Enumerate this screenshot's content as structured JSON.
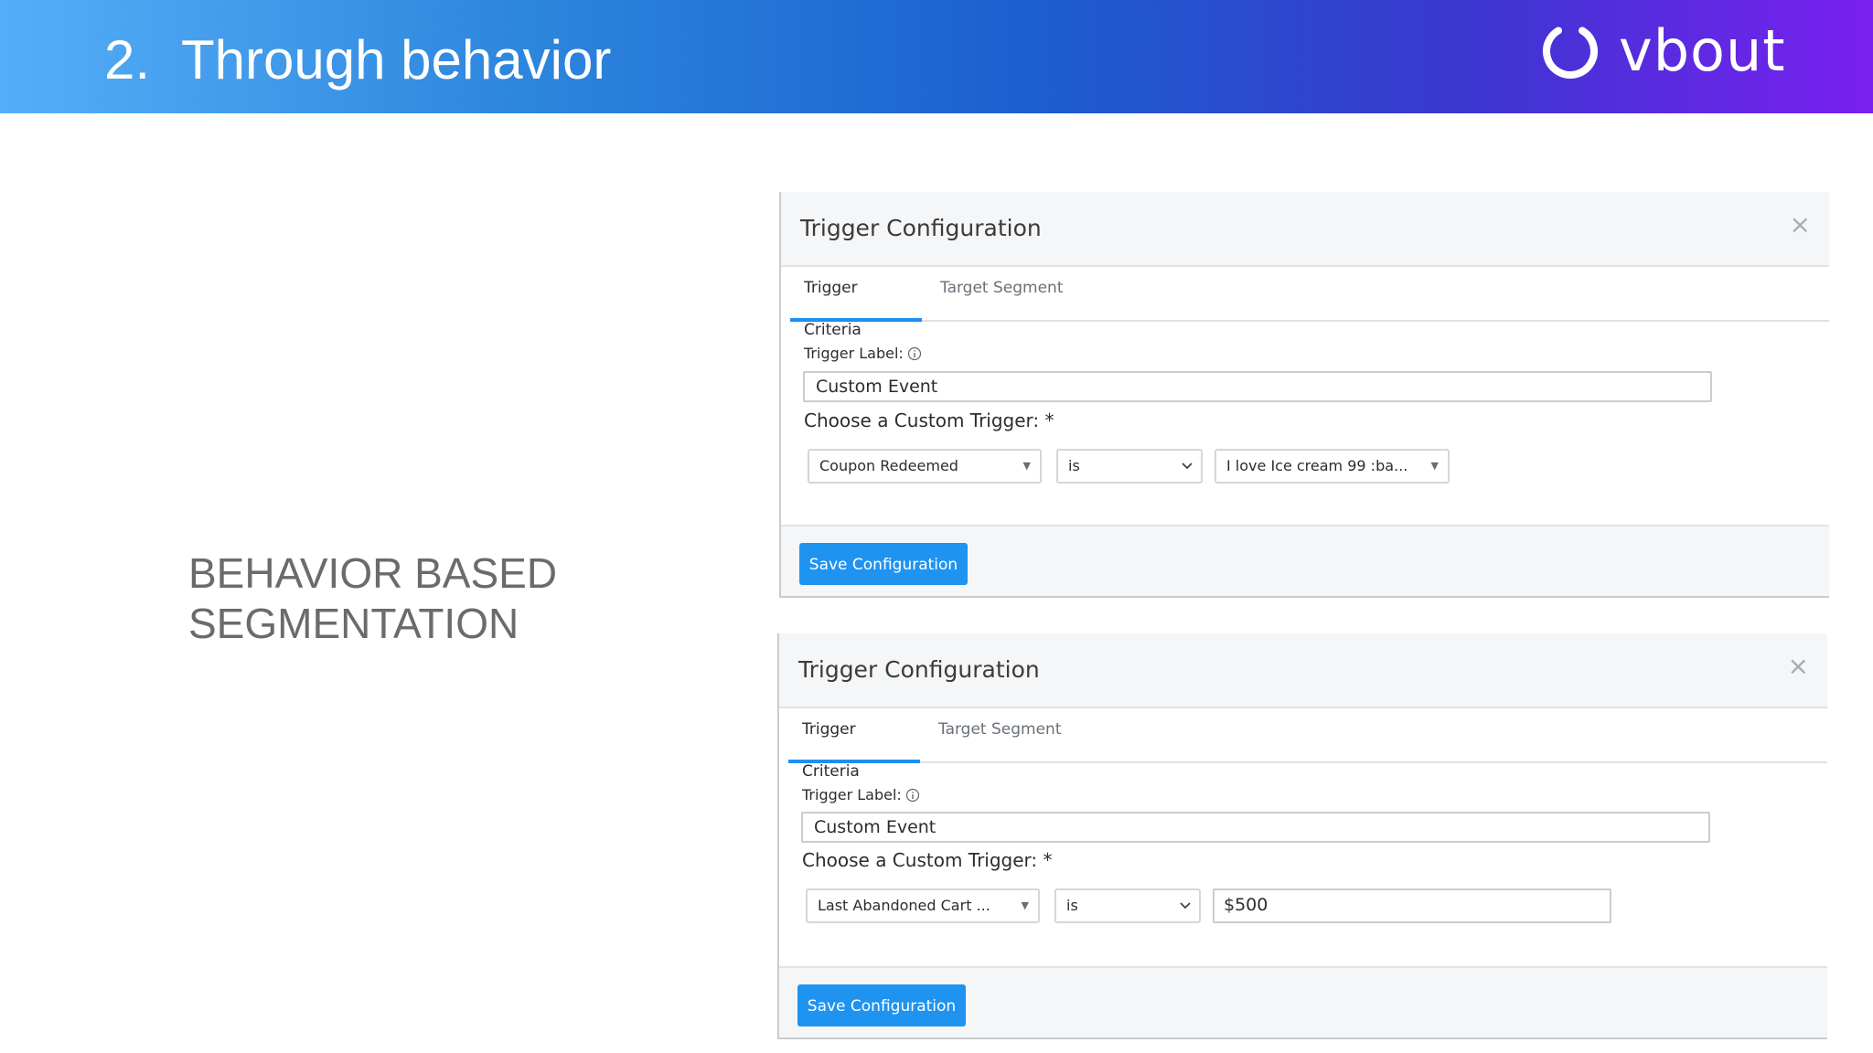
{
  "slide": {
    "number": "2.",
    "title": "Through behavior",
    "logo_text": "vbout",
    "side_text_line1": "BEHAVIOR BASED",
    "side_text_line2": "SEGMENTATION"
  },
  "panels": [
    {
      "title": "Trigger Configuration",
      "close": "×",
      "tabs": [
        "Trigger Criteria",
        "Target Segment"
      ],
      "trigger_label": "Trigger Label:",
      "trigger_label_value": "Custom Event",
      "choose_label": "Choose a Custom Trigger: *",
      "select1": "Coupon Redeemed",
      "select2": "is",
      "select3": "I love Ice cream 99 :ba...",
      "save_label": "Save Configuration"
    },
    {
      "title": "Trigger Configuration",
      "close": "×",
      "tabs": [
        "Trigger Criteria",
        "Target Segment"
      ],
      "trigger_label": "Trigger Label:",
      "trigger_label_value": "Custom Event",
      "choose_label": "Choose a Custom Trigger: *",
      "select1": "Last Abandoned Cart ...",
      "select2": "is",
      "value_input": "$500",
      "save_label": "Save Configuration"
    }
  ]
}
